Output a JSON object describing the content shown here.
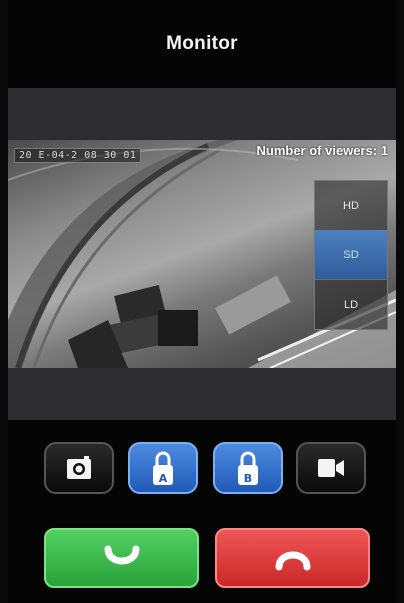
{
  "header": {
    "title": "Monitor"
  },
  "video": {
    "timestamp": "20 E-04-2 08 30 01",
    "viewers_text": "Number of viewers: 1"
  },
  "quality": {
    "options": [
      "HD",
      "SD",
      "LD"
    ],
    "selected": "SD",
    "selected_color": "#3f72b3"
  },
  "controls": {
    "icons": [
      "camera-icon",
      "lock-a-icon",
      "lock-b-icon",
      "video-camera-icon"
    ],
    "lock_a_letter": "A",
    "lock_b_letter": "B",
    "answer_icon": "phone-answer-icon",
    "hangup_icon": "phone-hangup-icon",
    "answer_color": "#2fb043",
    "hangup_color": "#d93a3a",
    "lock_color": "#2b6ccb"
  }
}
